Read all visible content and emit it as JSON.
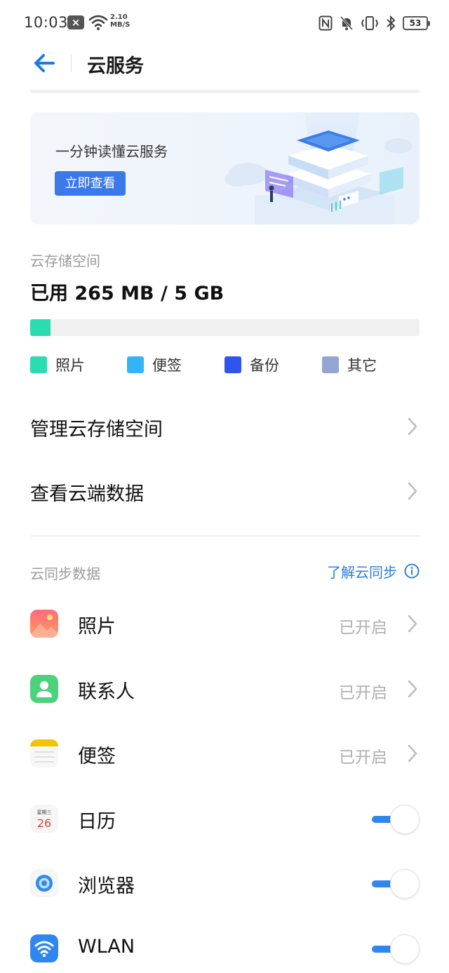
{
  "status_bar": {
    "time": "10:03",
    "net_speed_value": "2.10",
    "net_speed_unit": "MB/S",
    "battery": "53"
  },
  "header": {
    "title": "云服务"
  },
  "banner": {
    "title": "一分钟读懂云服务",
    "button_label": "立即查看"
  },
  "storage": {
    "label": "云存储空间",
    "used_text": "已用 265 MB / 5 GB",
    "used_fraction": 0.053,
    "legend": [
      {
        "label": "照片",
        "color": "#2bdcb1"
      },
      {
        "label": "便签",
        "color": "#33b5f5"
      },
      {
        "label": "备份",
        "color": "#2f55f0"
      },
      {
        "label": "其它",
        "color": "#94a5d4"
      }
    ]
  },
  "menu": {
    "manage": "管理云存储空间",
    "view": "查看云端数据"
  },
  "sync": {
    "section_label": "云同步数据",
    "learn_link": "了解云同步",
    "items": [
      {
        "name": "照片",
        "status": "已开启"
      },
      {
        "name": "联系人",
        "status": "已开启"
      },
      {
        "name": "便签",
        "status": "已开启"
      },
      {
        "name": "日历",
        "toggle": "on"
      },
      {
        "name": "浏览器",
        "toggle": "on"
      },
      {
        "name": "WLAN",
        "toggle": "on"
      }
    ]
  },
  "calendar_icon": {
    "weekday": "星期三",
    "day": "26"
  },
  "colors": {
    "accent": "#2f86ef",
    "banner_button": "#3b79e8",
    "link": "#2b7fe0"
  }
}
